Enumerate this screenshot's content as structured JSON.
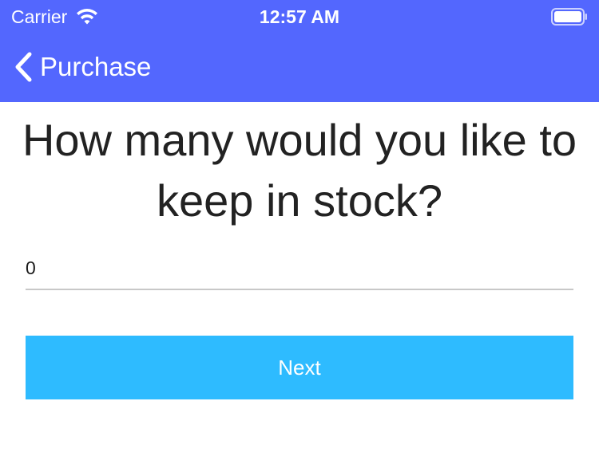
{
  "status_bar": {
    "carrier": "Carrier",
    "time": "12:57 AM",
    "wifi_icon": "wifi-icon",
    "battery_icon": "battery-icon"
  },
  "nav": {
    "back_label": "Purchase",
    "back_icon": "chevron-left-icon"
  },
  "main": {
    "question": "How many would you like to keep in stock?",
    "quantity_value": "0",
    "next_label": "Next"
  },
  "colors": {
    "header_background": "#5367fe",
    "button_background": "#2ebbff",
    "text": "#222222"
  }
}
